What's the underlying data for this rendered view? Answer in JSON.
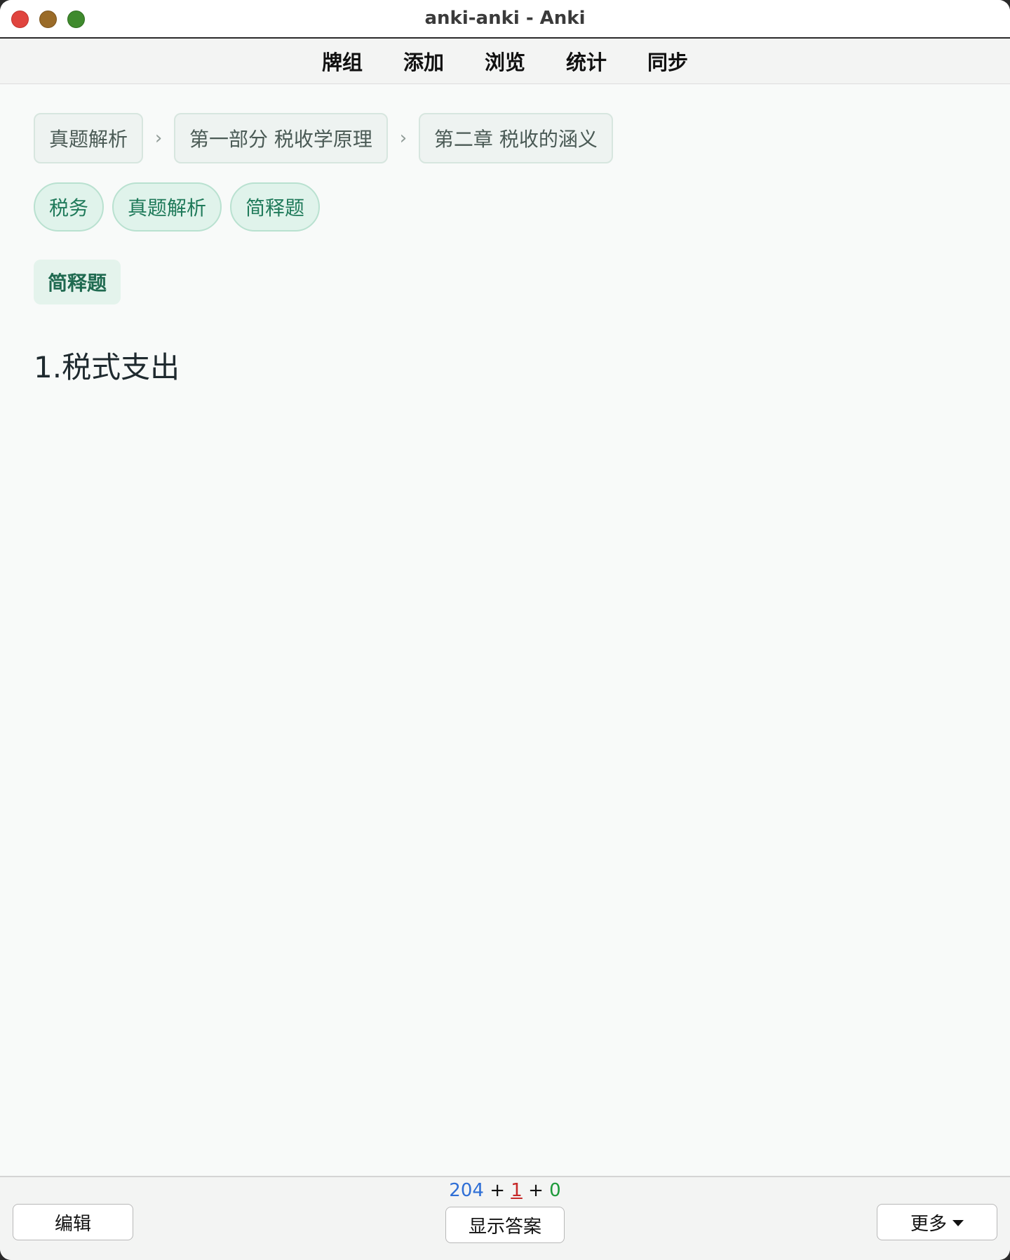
{
  "window": {
    "title": "anki-anki - Anki"
  },
  "topnav": {
    "items": [
      {
        "label": "牌组"
      },
      {
        "label": "添加"
      },
      {
        "label": "浏览"
      },
      {
        "label": "统计"
      },
      {
        "label": "同步"
      }
    ]
  },
  "card": {
    "breadcrumb": [
      {
        "label": "真题解析"
      },
      {
        "label": "第一部分 税收学原理"
      },
      {
        "label": "第二章 税收的涵义"
      }
    ],
    "breadcrumb_separator": "›",
    "tags": [
      {
        "label": "税务"
      },
      {
        "label": "真题解析"
      },
      {
        "label": "简释题"
      }
    ],
    "type_badge": "简释题",
    "question": "1.税式支出"
  },
  "bottombar": {
    "edit_label": "编辑",
    "show_answer_label": "显示答案",
    "more_label": "更多",
    "counts": {
      "new": "204",
      "learning": "1",
      "review": "0",
      "plus": "+"
    }
  },
  "colors": {
    "count_new": "#2f6fd6",
    "count_learning": "#c62828",
    "count_review": "#1d9a3a",
    "tag_text": "#1f7a5a",
    "tag_bg": "#e0f3eb"
  },
  "icons": {
    "close": "close-icon",
    "minimize": "minimize-icon",
    "zoom": "zoom-icon",
    "more_dropdown": "caret-down-icon"
  }
}
